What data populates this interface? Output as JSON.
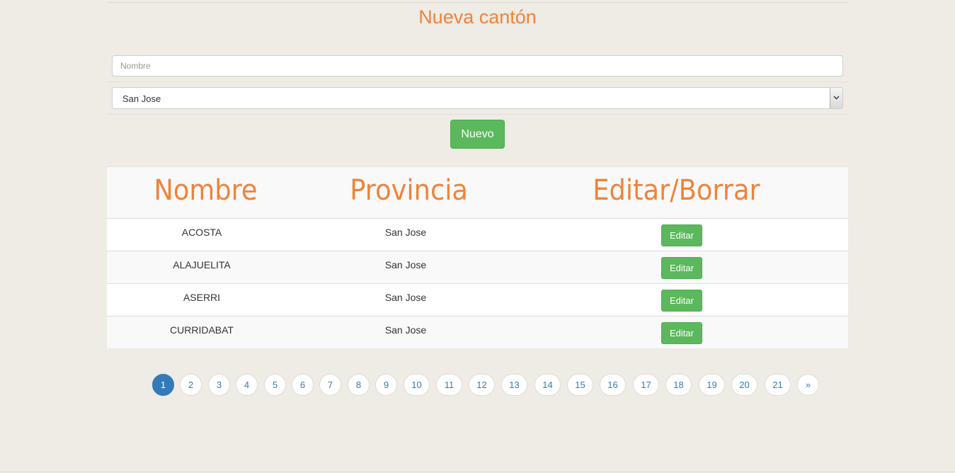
{
  "form": {
    "title": "Nueva cantón",
    "name_placeholder": "Nombre",
    "province_selected": "San Jose",
    "submit_label": "Nuevo"
  },
  "table": {
    "headers": [
      "Nombre",
      "Provincia",
      "Editar/Borrar"
    ],
    "rows": [
      {
        "nombre": "ACOSTA",
        "provincia": "San Jose",
        "action": "Editar"
      },
      {
        "nombre": "ALAJUELITA",
        "provincia": "San Jose",
        "action": "Editar"
      },
      {
        "nombre": "ASERRI",
        "provincia": "San Jose",
        "action": "Editar"
      },
      {
        "nombre": "CURRIDABAT",
        "provincia": "San Jose",
        "action": "Editar"
      }
    ]
  },
  "pagination": {
    "pages": [
      "1",
      "2",
      "3",
      "4",
      "5",
      "6",
      "7",
      "8",
      "9",
      "10",
      "11",
      "12",
      "13",
      "14",
      "15",
      "16",
      "17",
      "18",
      "19",
      "20",
      "21",
      "»"
    ],
    "current": "1"
  },
  "colors": {
    "accent_orange": "#f0833a",
    "button_green": "#5cb85c",
    "link_blue": "#337ab7",
    "background": "#efebe5"
  }
}
